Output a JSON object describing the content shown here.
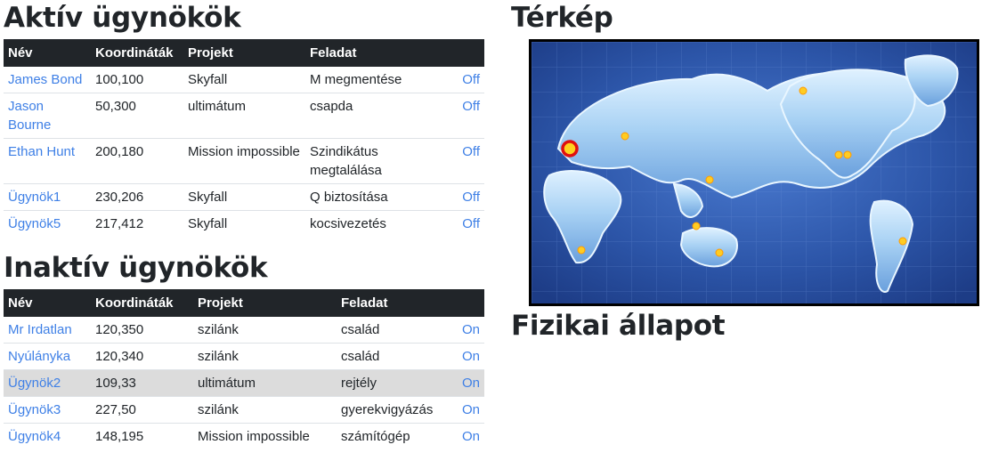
{
  "active": {
    "title": "Aktív ügynökök",
    "headers": [
      "Név",
      "Koordináták",
      "Projekt",
      "Feladat",
      ""
    ],
    "rows": [
      {
        "name": "James Bond",
        "coords": "100,100",
        "project": "Skyfall",
        "task": "M megmentése",
        "status": "Off"
      },
      {
        "name": "Jason Bourne",
        "coords": "50,300",
        "project": "ultimátum",
        "task": "csapda",
        "status": "Off"
      },
      {
        "name": "Ethan Hunt",
        "coords": "200,180",
        "project": "Mission impossible",
        "task": "Szindikátus megtalálása",
        "status": "Off"
      },
      {
        "name": "Ügynök1",
        "coords": "230,206",
        "project": "Skyfall",
        "task": "Q biztosítása",
        "status": "Off"
      },
      {
        "name": "Ügynök5",
        "coords": "217,412",
        "project": "Skyfall",
        "task": "kocsivezetés",
        "status": "Off"
      }
    ]
  },
  "inactive": {
    "title": "Inaktív ügynökök",
    "headers": [
      "Név",
      "Koordináták",
      "Projekt",
      "Feladat",
      ""
    ],
    "rows": [
      {
        "name": "Mr Irdatlan",
        "coords": "120,350",
        "project": "szilánk",
        "task": "család",
        "status": "On"
      },
      {
        "name": "Nyúlányka",
        "coords": "120,340",
        "project": "szilánk",
        "task": "család",
        "status": "On"
      },
      {
        "name": "Ügynök2",
        "coords": "109,33",
        "project": "ultimátum",
        "task": "rejtély",
        "status": "On"
      },
      {
        "name": "Ügynök3",
        "coords": "227,50",
        "project": "szilánk",
        "task": "gyerekvigyázás",
        "status": "On"
      },
      {
        "name": "Ügynök4",
        "coords": "148,195",
        "project": "Mission impossible",
        "task": "számítógép",
        "status": "On"
      }
    ]
  },
  "map": {
    "title": "Térkép"
  },
  "physical": {
    "title": "Fizikai állapot"
  },
  "colors": {
    "link": "#3f80e6",
    "header_bg": "#212529",
    "highlight_row": "#dcdcdc"
  }
}
